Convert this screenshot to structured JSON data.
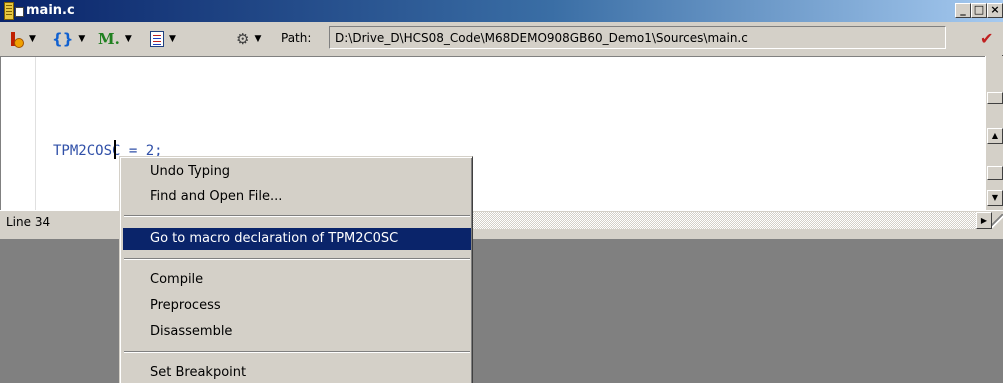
{
  "window": {
    "title": "main.c",
    "minimize": "_",
    "maximize": "□",
    "close": "×"
  },
  "toolbar": {
    "items": [
      {
        "icon": "make-icon"
      },
      {
        "icon": "braces-icon",
        "glyph": "{}"
      },
      {
        "icon": "marker-icon",
        "glyph": "M."
      },
      {
        "icon": "document-list-icon"
      },
      {
        "icon": "gear-icon",
        "glyph": "⚙"
      }
    ],
    "dropdown_glyph": "▼",
    "path_label": "Path:",
    "path_value": "D:\\Drive_D\\HCS08_Code\\M68DEMO908GB60_Demo1\\Sources\\main.c",
    "check_glyph": "✔"
  },
  "editor": {
    "code_line": "TPM2COSC = 2;"
  },
  "statusbar": {
    "line": "Line 34"
  },
  "scroll": {
    "up": "▲",
    "down": "▼",
    "right": "▶"
  },
  "context_menu": {
    "items": [
      {
        "label": "Undo Typing"
      },
      {
        "label": "Find and Open File..."
      },
      {
        "label": "Go to macro declaration of TPM2C0SC",
        "selected": true
      },
      {
        "label": "Compile"
      },
      {
        "label": "Preprocess"
      },
      {
        "label": "Disassemble"
      },
      {
        "label": "Set Breakpoint"
      }
    ]
  },
  "colors": {
    "title_gradient_start": "#0a246a",
    "selection": "#0a246a",
    "code_text": "#3050a8",
    "face": "#d4d0c8",
    "desktop": "#808080"
  }
}
